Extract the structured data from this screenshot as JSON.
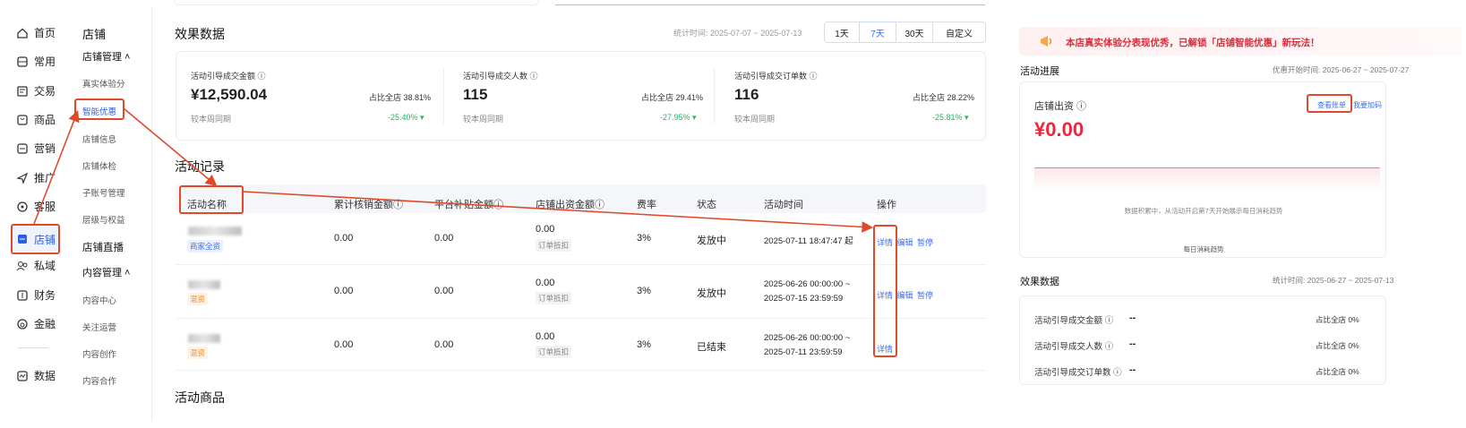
{
  "nav_primary": [
    {
      "label": "首页",
      "icon": "home-icon"
    },
    {
      "label": "常用",
      "icon": "bookmark-icon"
    },
    {
      "label": "交易",
      "icon": "order-icon"
    },
    {
      "label": "商品",
      "icon": "goods-icon"
    },
    {
      "label": "营销",
      "icon": "marketing-icon"
    },
    {
      "label": "推广",
      "icon": "send-icon"
    },
    {
      "label": "客服",
      "icon": "service-icon"
    },
    {
      "label": "店铺",
      "icon": "shop-icon"
    },
    {
      "label": "私域",
      "icon": "users-icon"
    },
    {
      "label": "财务",
      "icon": "finance-icon"
    },
    {
      "label": "金融",
      "icon": "coin-icon"
    },
    {
      "label": "数据",
      "icon": "data-icon"
    }
  ],
  "nav_secondary": {
    "title": "店铺",
    "group1": "店铺管理 ˄",
    "items1": [
      "真实体验分",
      "智能优惠",
      "店铺信息",
      "店铺体检",
      "子账号管理",
      "层级与权益"
    ],
    "group2": "店铺直播",
    "group3": "内容管理 ˄",
    "items3": [
      "内容中心",
      "关注运营",
      "内容创作",
      "内容合作"
    ]
  },
  "effect": {
    "title": "效果数据",
    "stat_time": "统计时间:  2025-07-07 ~ 2025-07-13",
    "ranges": [
      "1天",
      "7天",
      "30天",
      "自定义"
    ],
    "metrics": [
      {
        "label": "活动引导成交金额 ⓘ",
        "value": "¥12,590.04",
        "share": "占比全店 38.81%",
        "cmp": "较本周同期",
        "delta": "-25.40% ▾"
      },
      {
        "label": "活动引导成交人数 ⓘ",
        "value": "115",
        "share": "占比全店 29.41%",
        "cmp": "较本周同期",
        "delta": "-27.95% ▾"
      },
      {
        "label": "活动引导成交订单数 ⓘ",
        "value": "116",
        "share": "占比全店 28.22%",
        "cmp": "较本周同期",
        "delta": "-25.81% ▾"
      }
    ]
  },
  "records": {
    "title": "活动记录",
    "headers": [
      "活动名称",
      "累计核销金额ⓘ",
      "平台补贴金额ⓘ",
      "店铺出资金额ⓘ",
      "费率",
      "状态",
      "活动时间",
      "操作"
    ],
    "rows": [
      {
        "tag": "商家全资",
        "c1": "0.00",
        "c2": "0.00",
        "c3": "0.00",
        "c3sub": "订单抵扣",
        "rate": "3%",
        "status": "发放中",
        "time1": "2025-07-11 18:47:47 起",
        "time2": "",
        "ops": [
          "详情",
          "编辑",
          "暂停"
        ]
      },
      {
        "tag": "混资",
        "c1": "0.00",
        "c2": "0.00",
        "c3": "0.00",
        "c3sub": "订单抵扣",
        "rate": "3%",
        "status": "发放中",
        "time1": "2025-06-26 00:00:00 ~",
        "time2": "2025-07-15 23:59:59",
        "ops": [
          "详情",
          "编辑",
          "暂停"
        ]
      },
      {
        "tag": "混资",
        "c1": "0.00",
        "c2": "0.00",
        "c3": "0.00",
        "c3sub": "订单抵扣",
        "rate": "3%",
        "status": "已结束",
        "time1": "2025-06-26 00:00:00 ~",
        "time2": "2025-07-11 23:59:59",
        "ops": [
          "详情"
        ]
      }
    ]
  },
  "goods_title": "活动商品",
  "right": {
    "banner": "本店真实体验分表现优秀，已解锁「店铺智能优惠」新玩法！",
    "progress_title": "活动进展",
    "progress_time": "优惠开始时间:  2025-06-27 ~ 2025-07-27",
    "invest_label": "店铺出资 ⓘ",
    "invest_value": "¥0.00",
    "view_bill": "查看账单",
    "boost": "我要加码",
    "chart_note": "数据积累中，从活动开启第7天开始展示每日消耗趋势",
    "chart_caption": "每日消耗趋势",
    "effect_title": "效果数据",
    "effect_time": "统计时间:  2025-06-27 ~ 2025-07-13",
    "effect_rows": [
      {
        "label": "活动引导成交金额 ⓘ",
        "value": "--",
        "share": "占比全店 0%"
      },
      {
        "label": "活动引导成交人数 ⓘ",
        "value": "--",
        "share": "占比全店 0%"
      },
      {
        "label": "活动引导成交订单数 ⓘ",
        "value": "--",
        "share": "占比全店 0%"
      }
    ]
  },
  "colors": {
    "accent": "#3b6ef5",
    "red": "#f0253a",
    "annotation": "#e04a2b",
    "green": "#22b35e"
  }
}
